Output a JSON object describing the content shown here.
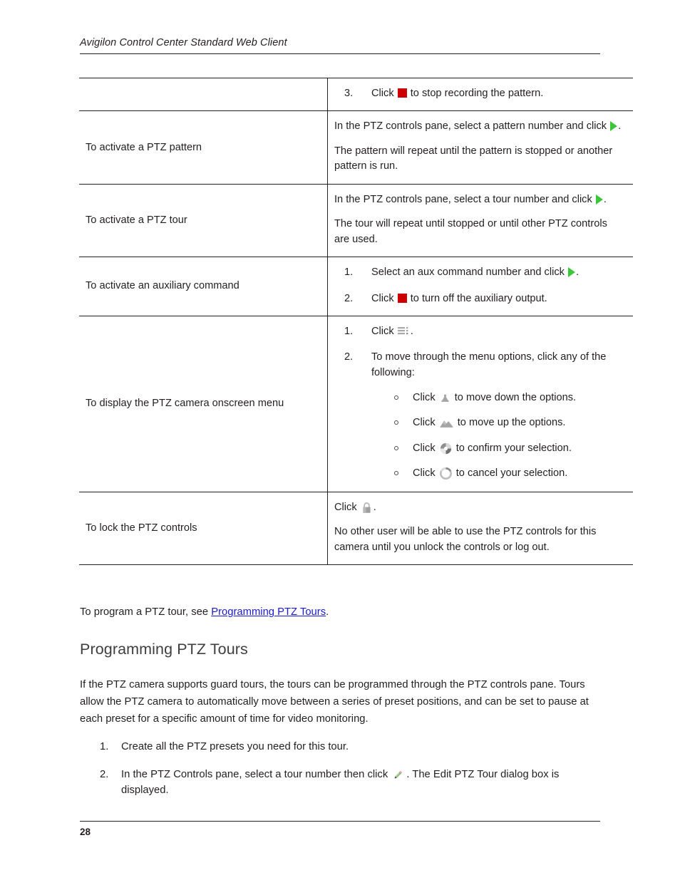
{
  "header": {
    "title": "Avigilon Control Center Standard Web Client"
  },
  "table": {
    "rows": [
      {
        "label": "",
        "steps": [
          {
            "num": "3.",
            "pre": "Click ",
            "icon": "stop-icon",
            "post": " to stop recording the pattern."
          }
        ]
      },
      {
        "label": "To activate a PTZ pattern",
        "paragraphs": [
          {
            "pre": "In the PTZ controls pane, select a pattern number and click ",
            "icon": "play-icon",
            "post": "."
          },
          {
            "pre": "The pattern will repeat until the pattern is stopped or another pattern is run.",
            "icon": "",
            "post": ""
          }
        ]
      },
      {
        "label": "To activate a PTZ tour",
        "paragraphs": [
          {
            "pre": "In the PTZ controls pane, select a tour number and click ",
            "icon": "play-icon",
            "post": "."
          },
          {
            "pre": "The tour will repeat until stopped or until other PTZ controls are used.",
            "icon": "",
            "post": ""
          }
        ]
      },
      {
        "label": "To activate an auxiliary command",
        "steps": [
          {
            "num": "1.",
            "pre": "Select an aux command number and click ",
            "icon": "play-icon",
            "post": "."
          },
          {
            "num": "2.",
            "pre": "Click ",
            "icon": "stop-icon",
            "post": " to turn off the auxiliary output."
          }
        ]
      },
      {
        "label": "To display the PTZ camera onscreen menu",
        "steps": [
          {
            "num": "1.",
            "pre": "Click ",
            "icon": "menu-icon",
            "post": "."
          },
          {
            "num": "2.",
            "pre": "To move through the menu options, click any of the following:",
            "icon": "",
            "post": ""
          }
        ],
        "subitems": [
          {
            "pre": "Click ",
            "icon": "move-down-icon",
            "post": " to move down the options."
          },
          {
            "pre": "Click ",
            "icon": "move-up-icon",
            "post": " to move up the options."
          },
          {
            "pre": "Click ",
            "icon": "confirm-icon",
            "post": " to confirm your selection."
          },
          {
            "pre": "Click ",
            "icon": "cancel-icon",
            "post": " to cancel your selection."
          }
        ]
      },
      {
        "label": "To lock the PTZ controls",
        "paragraphs": [
          {
            "pre": "Click ",
            "icon": "lock-icon",
            "post": "."
          },
          {
            "pre": "No other user will be able to use the PTZ controls for this camera until you unlock the controls or log out.",
            "icon": "",
            "post": ""
          }
        ]
      }
    ]
  },
  "link_line": {
    "pre": "To program a PTZ tour, see ",
    "link_text": "Programming PTZ Tours",
    "post": "."
  },
  "section": {
    "heading": "Programming PTZ Tours",
    "paragraph": "If the PTZ camera supports guard tours, the tours can be programmed through the PTZ controls pane. Tours allow the PTZ camera to automatically move between a series of preset positions, and can be set to pause at each preset for a specific amount of time for video monitoring."
  },
  "bottom_list": [
    {
      "num": "1.",
      "pre": "Create all the PTZ presets you need for this tour.",
      "icon": "",
      "post": ""
    },
    {
      "num": "2.",
      "pre": "In the PTZ Controls pane, select a tour number then click ",
      "icon": "edit-pencil-icon",
      "post": ". The Edit PTZ Tour dialog box is displayed."
    }
  ],
  "footer": {
    "page_number": "28"
  },
  "colors": {
    "stop_red": "#cc0000",
    "play_green": "#3cc63c",
    "link_blue": "#1a1ad6",
    "icon_gray": "#9a9a9a",
    "text": "#231f20",
    "heading_gray": "#3f3f3f"
  }
}
